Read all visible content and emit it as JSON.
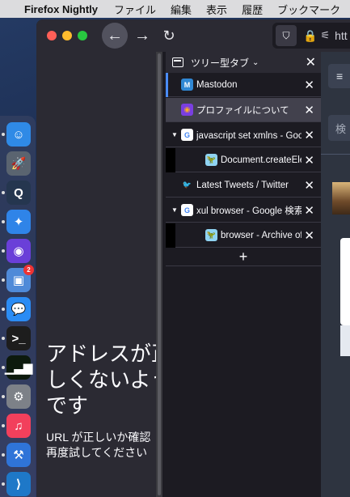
{
  "menubar": {
    "apple_glyph": "",
    "app_name": "Firefox Nightly",
    "items": [
      "ファイル",
      "編集",
      "表示",
      "履歴",
      "ブックマーク"
    ]
  },
  "dock": {
    "apps": [
      {
        "name": "finder",
        "glyph": "☺",
        "color": "#2f8ae6",
        "running": true
      },
      {
        "name": "launchpad",
        "glyph": "🚀",
        "color": "#5a6470",
        "running": false
      },
      {
        "name": "quicktime",
        "glyph": "Q",
        "color": "#25364f",
        "running": true
      },
      {
        "name": "safari",
        "glyph": "✦",
        "color": "#2f84e8",
        "running": true
      },
      {
        "name": "firefox-nightly",
        "glyph": "◉",
        "color": "#6a3fd8",
        "running": true
      },
      {
        "name": "preview",
        "glyph": "▣",
        "color": "#4f8ad8",
        "running": true,
        "badge": "2"
      },
      {
        "name": "messages",
        "glyph": "💬",
        "color": "#2b8cf4",
        "running": true
      },
      {
        "name": "terminal",
        "glyph": ">_",
        "color": "#1d1d1d",
        "running": true
      },
      {
        "name": "activity-monitor",
        "glyph": "▁▃▆",
        "color": "#0d1a0d",
        "running": true
      },
      {
        "name": "system-preferences",
        "glyph": "⚙",
        "color": "#7d8188",
        "running": true
      },
      {
        "name": "music",
        "glyph": "♫",
        "color": "#f2405c",
        "running": true
      },
      {
        "name": "xcode",
        "glyph": "⚒",
        "color": "#2f74d8",
        "running": true
      },
      {
        "name": "vscode",
        "glyph": "⟩",
        "color": "#1e78c8",
        "running": true
      }
    ]
  },
  "toolbar": {
    "back_glyph": "←",
    "forward_glyph": "→",
    "reload_glyph": "↻",
    "url_partial": "htt"
  },
  "error_page": {
    "title": "アドレスが正\nしくないよう\nです",
    "description": "URL が正しいか確認\n再度試してください"
  },
  "sidebar": {
    "title": "ツリー型タブ",
    "tabs": [
      {
        "label": "Mastodon",
        "favicon": "mastodon",
        "active": false,
        "level": 0,
        "twisty": "",
        "blue_bar": true
      },
      {
        "label": "プロファイルについて",
        "favicon": "firefox",
        "active": true,
        "level": 0,
        "twisty": ""
      },
      {
        "label": "javascript set xmlns - Google 検索",
        "favicon": "google",
        "active": false,
        "level": 0,
        "twisty": "▼"
      },
      {
        "label": "Document.createElementNS()",
        "favicon": "mdn",
        "active": false,
        "level": 1,
        "twisty": ""
      },
      {
        "label": "Latest Tweets / Twitter",
        "favicon": "twitter",
        "active": false,
        "level": 0,
        "twisty": ""
      },
      {
        "label": "xul browser - Google 検索",
        "favicon": "google",
        "active": false,
        "level": 0,
        "twisty": "▼"
      },
      {
        "label": "browser - Archive of obsolete content",
        "favicon": "mdn",
        "active": false,
        "level": 1,
        "twisty": ""
      }
    ],
    "new_tab_glyph": "+"
  },
  "right_page": {
    "menu_glyph": "≡",
    "search_glyph": "検"
  }
}
